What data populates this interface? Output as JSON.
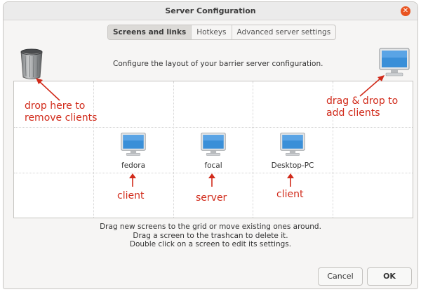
{
  "window": {
    "title": "Server Configuration"
  },
  "tabs": [
    {
      "label": "Screens and links",
      "active": true
    },
    {
      "label": "Hotkeys",
      "active": false
    },
    {
      "label": "Advanced server settings",
      "active": false
    }
  ],
  "hint": "Configure the layout of your barrier server configuration.",
  "screens": [
    {
      "name": "fedora",
      "annotation": "client"
    },
    {
      "name": "focal",
      "annotation": "server"
    },
    {
      "name": "Desktop-PC",
      "annotation": "client"
    }
  ],
  "annotations": {
    "trash_line1": "drop here to",
    "trash_line2": "remove clients",
    "add_line1": "drag & drop to",
    "add_line2": "add clients"
  },
  "instructions": [
    "Drag new screens to the grid or move existing ones around.",
    "Drag a screen to the trashcan to delete it.",
    "Double click on a screen to edit its settings."
  ],
  "buttons": {
    "cancel": "Cancel",
    "ok": "OK"
  },
  "colors": {
    "annotation_red": "#d12a1a",
    "close_orange": "#e95420",
    "monitor_blue": "#3a8fd8"
  },
  "icons": {
    "close": "close-icon",
    "trash": "trash-icon",
    "monitor": "monitor-icon"
  }
}
